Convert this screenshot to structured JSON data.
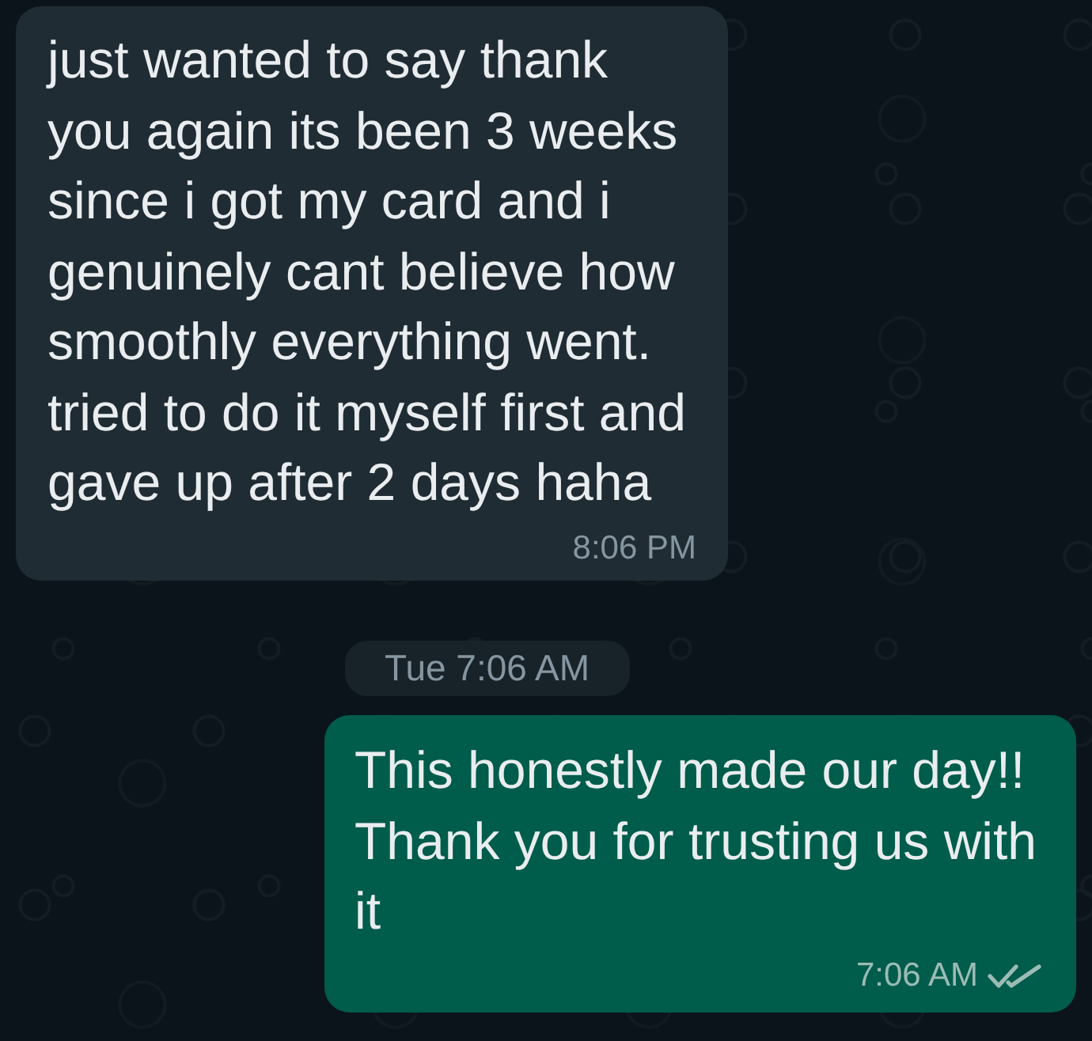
{
  "messages": [
    {
      "kind": "incoming",
      "text": "just wanted to say thank you again its been 3 weeks since i got my card and i genuinely cant believe how smoothly everything went. tried to do it myself first and gave up after 2 days haha",
      "time": "8:06 PM"
    },
    {
      "kind": "date_divider",
      "text": "Tue 7:06 AM"
    },
    {
      "kind": "outgoing",
      "text": "This honestly made our day!! Thank you for trusting us with it",
      "time": "7:06 AM",
      "read": false
    }
  ]
}
